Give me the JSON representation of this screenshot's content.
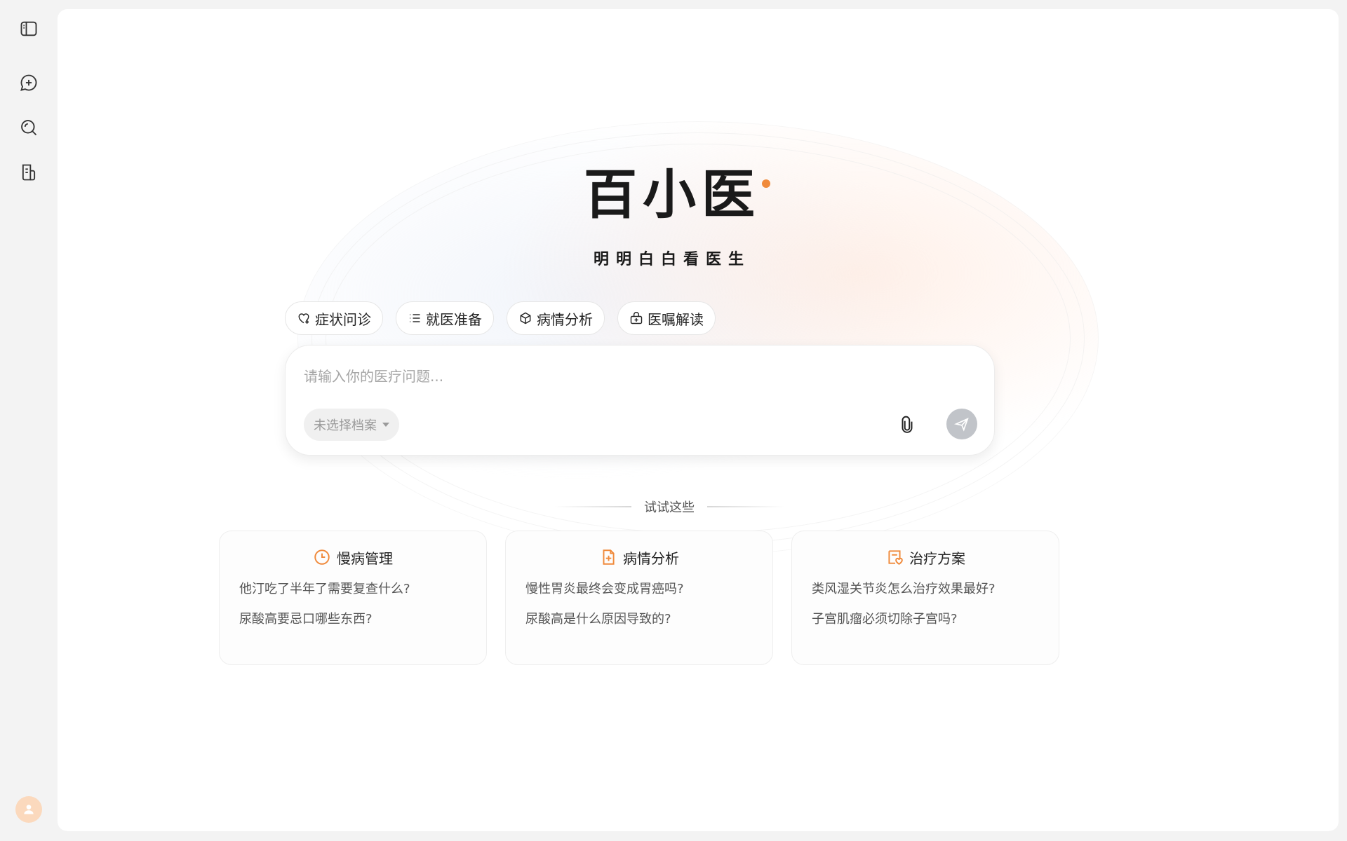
{
  "sidebar": {
    "items": [
      {
        "name": "toggle-sidebar",
        "icon": "sidebar-panel-icon"
      },
      {
        "name": "new-chat",
        "icon": "chat-plus-icon"
      },
      {
        "name": "search",
        "icon": "search-icon"
      },
      {
        "name": "records",
        "icon": "document-icon"
      }
    ],
    "avatar_icon": "user-icon"
  },
  "brand": {
    "logo": "百小医",
    "slogan": "明明白白看医生",
    "accent_color": "#f08a3b"
  },
  "chips": [
    {
      "label": "症状问诊",
      "icon": "heart-stethoscope-icon"
    },
    {
      "label": "就医准备",
      "icon": "list-icon"
    },
    {
      "label": "病情分析",
      "icon": "cube-icon"
    },
    {
      "label": "医嘱解读",
      "icon": "doctor-bag-icon"
    }
  ],
  "input": {
    "placeholder": "请输入你的医疗问题...",
    "value": "",
    "profile_select": "未选择档案"
  },
  "try_section": {
    "label": "试试这些"
  },
  "cards": [
    {
      "title": "慢病管理",
      "icon": "clock-icon",
      "questions": [
        "他汀吃了半年了需要复查什么?",
        "尿酸高要忌口哪些东西?"
      ]
    },
    {
      "title": "病情分析",
      "icon": "file-plus-icon",
      "questions": [
        "慢性胃炎最终会变成胃癌吗?",
        "尿酸高是什么原因导致的?"
      ]
    },
    {
      "title": "治疗方案",
      "icon": "clipboard-heart-icon",
      "questions": [
        "类风湿关节炎怎么治疗效果最好?",
        "子宫肌瘤必须切除子宫吗?"
      ]
    }
  ]
}
